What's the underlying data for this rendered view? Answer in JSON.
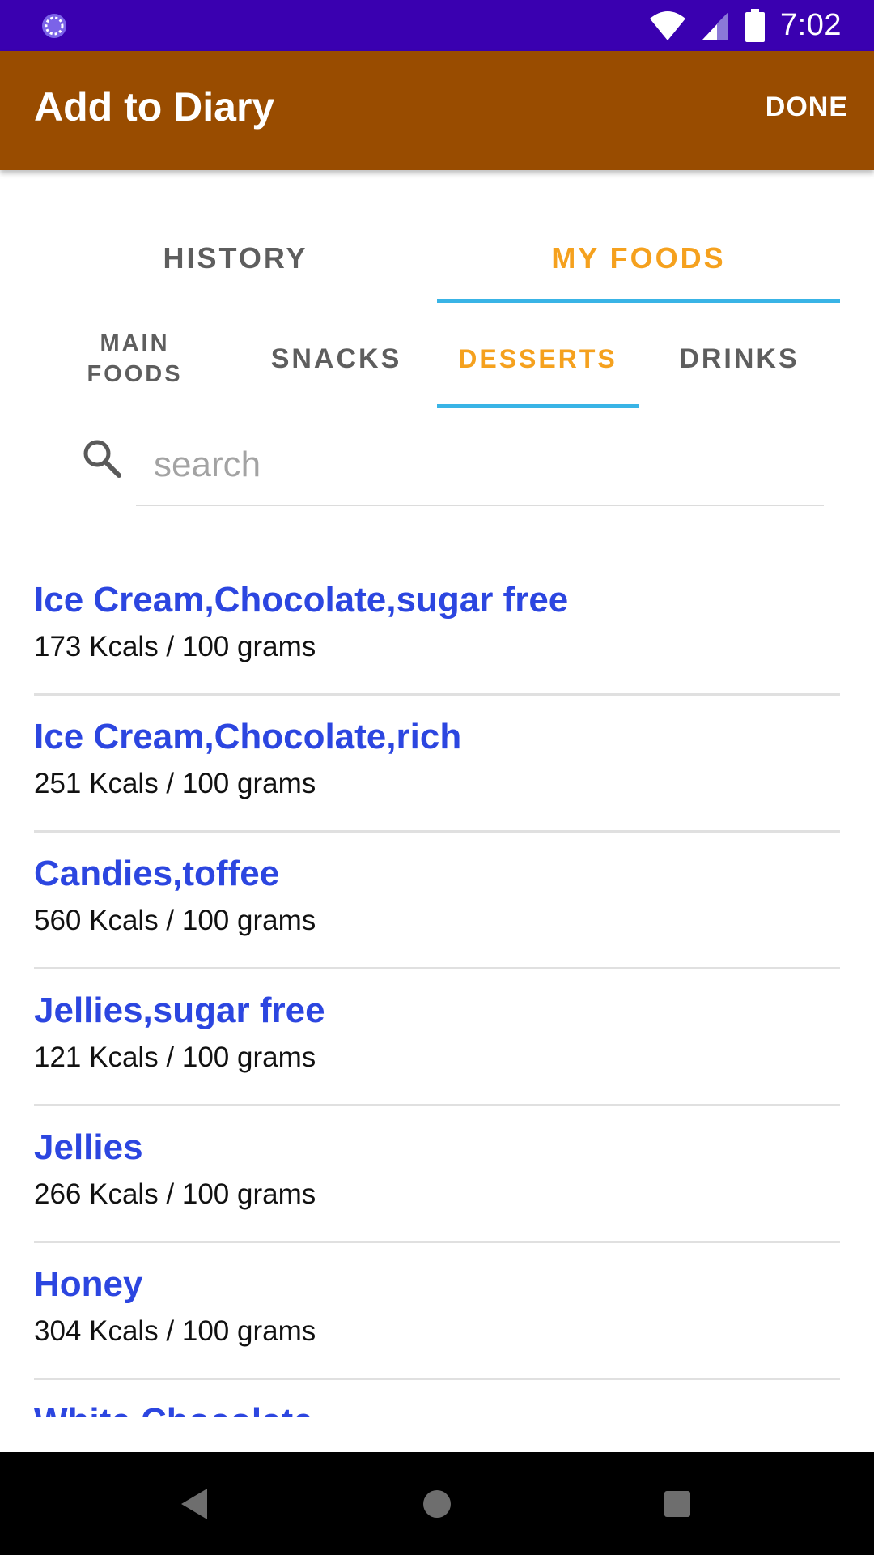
{
  "status_bar": {
    "time": "7:02",
    "left_icon": "sync-circle-icon",
    "icons": [
      "wifi-icon",
      "signal-icon",
      "battery-icon"
    ]
  },
  "app_bar": {
    "title": "Add to Diary",
    "done_label": "DONE",
    "background": "#994c00"
  },
  "top_tabs": [
    {
      "label": "HISTORY",
      "selected": false
    },
    {
      "label": "MY FOODS",
      "selected": true
    }
  ],
  "sub_tabs": [
    {
      "label": "MAIN FOODS",
      "line1": "MAIN",
      "line2": "FOODS",
      "selected": false
    },
    {
      "label": "SNACKS",
      "selected": false
    },
    {
      "label": "DESSERTS",
      "selected": true
    },
    {
      "label": "DRINKS",
      "selected": false
    }
  ],
  "search": {
    "placeholder": "search",
    "value": ""
  },
  "foods": [
    {
      "name": "Ice Cream,Chocolate,sugar free",
      "kcal": "173 Kcals / 100 grams"
    },
    {
      "name": "Ice Cream,Chocolate,rich",
      "kcal": "251 Kcals / 100 grams"
    },
    {
      "name": "Candies,toffee",
      "kcal": "560 Kcals / 100 grams"
    },
    {
      "name": "Jellies,sugar free",
      "kcal": "121 Kcals / 100 grams"
    },
    {
      "name": "Jellies",
      "kcal": "266 Kcals / 100 grams"
    },
    {
      "name": "Honey",
      "kcal": "304 Kcals / 100 grams"
    },
    {
      "name": "White Chocolate",
      "kcal": ""
    }
  ],
  "colors": {
    "status_bar": "#3a00b0",
    "accent_orange": "#f5a11e",
    "indicator_blue": "#39b4e6",
    "food_name_blue": "#2c46e0"
  },
  "nav_bar": {
    "buttons": [
      "back-icon",
      "home-icon",
      "recents-icon"
    ]
  }
}
